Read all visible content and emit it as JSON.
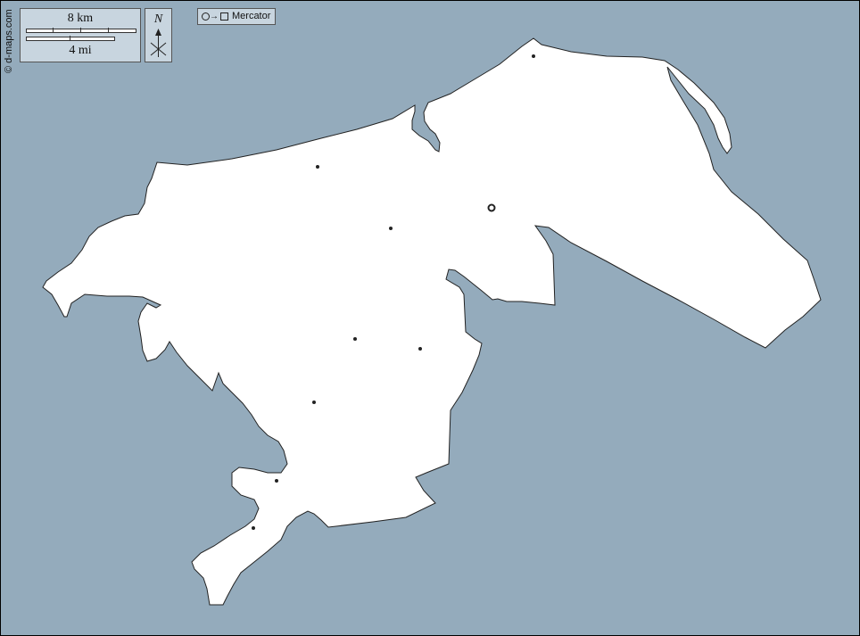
{
  "credit": "© d-maps.com",
  "scale": {
    "km_label": "8 km",
    "mi_label": "4 mi"
  },
  "north": {
    "label": "N"
  },
  "projection": {
    "label": "Mercator"
  },
  "colors": {
    "water": "#94abbc",
    "land": "#ffffff",
    "panel": "#c8d5df"
  }
}
